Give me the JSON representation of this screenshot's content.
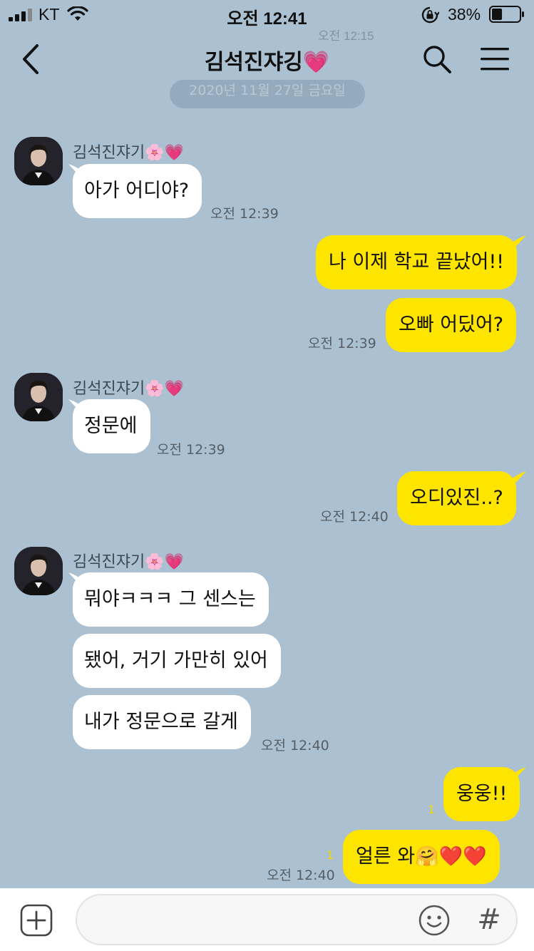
{
  "status_bar": {
    "carrier": "KT",
    "time": "오전 12:41",
    "battery_percent": "38%",
    "battery_level": 0.38,
    "ghost_time": "오전 12:15"
  },
  "header": {
    "title": "김석진쟈깅💗"
  },
  "date_divider": "2020년 11월 27일 금요일",
  "sender_name": "김석진쟈기🌸💗",
  "messages": [
    {
      "side": "in",
      "text": "아가 어디야?"
    },
    {
      "side": "out",
      "text": "나 이제 학교 끝났어!!"
    },
    {
      "side": "out",
      "text": "오빠 어딨어?"
    },
    {
      "side": "in",
      "text": "정문에"
    },
    {
      "side": "out",
      "text": "오디있진..?"
    },
    {
      "side": "in",
      "text": "뭐야ㅋㅋㅋ 그 센스는"
    },
    {
      "side": "in",
      "text": "됐어, 거기 가만히 있어"
    },
    {
      "side": "in",
      "text": "내가 정문으로 갈게"
    },
    {
      "side": "out",
      "text": "웅웅!!"
    },
    {
      "side": "out",
      "text": "얼른 와🤗❤️❤️"
    }
  ],
  "times": [
    "오전 12:39",
    "오전 12:39",
    "오전 12:39",
    "오전 12:40",
    "오전 12:40",
    "오전 12:40"
  ],
  "unread_counts": [
    "1",
    "1"
  ],
  "input": {
    "value": "",
    "hashtag_label": "#"
  },
  "colors": {
    "background": "#abc1d1",
    "out_bubble": "#fee500",
    "in_bubble": "#ffffff",
    "unread": "#f2d600"
  }
}
